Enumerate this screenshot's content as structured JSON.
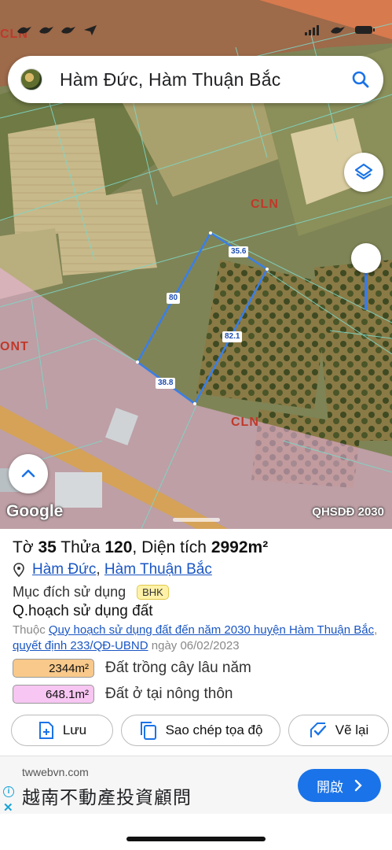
{
  "search": {
    "query": "Hàm Đức, Hàm Thuận Bắc"
  },
  "map": {
    "zone_labels": [
      "CLN",
      "CLN",
      "CLN",
      "ONT"
    ],
    "edge_lengths": [
      "35.6",
      "80",
      "82.1",
      "38.8"
    ],
    "google": "Google",
    "layer_name": "QHSDĐ 2030"
  },
  "parcel": {
    "title_prefix": "Tờ",
    "sheet_no": "35",
    "plot_word": "Thửa",
    "plot_no": "120",
    "area_word": "Diện tích",
    "area": "2992m²",
    "commune": "Hàm Đức",
    "district": "Hàm Thuận Bắc",
    "purpose_label": "Mục đích sử dụng",
    "purpose_code": "BHK",
    "plan_title": "Q.hoạch sử dụng đất",
    "plan_prefix": "Thuộc",
    "plan_link": "Quy hoạch sử dụng đất đến năm 2030 huyện Hàm Thuận Bắc",
    "decision_link": "quyết định 233/QĐ-UBND",
    "decision_date": "ngày 06/02/2023",
    "breakdown": [
      {
        "area": "2344m²",
        "label": "Đất trồng cây lâu năm",
        "color": "#f8c98b"
      },
      {
        "area": "648.1m²",
        "label": "Đất ở tại nông thôn",
        "color": "#f7c6f2"
      }
    ]
  },
  "actions": {
    "save": "Lưu",
    "copy": "Sao chép tọa độ",
    "redraw": "Vẽ lại"
  },
  "ad": {
    "domain": "twwebvn.com",
    "title": "越南不動產投資顧問",
    "button": "開啟"
  },
  "colors": {
    "accent": "#1a73e8",
    "link": "#1a56c4",
    "parcel": "#3a7ee8"
  }
}
